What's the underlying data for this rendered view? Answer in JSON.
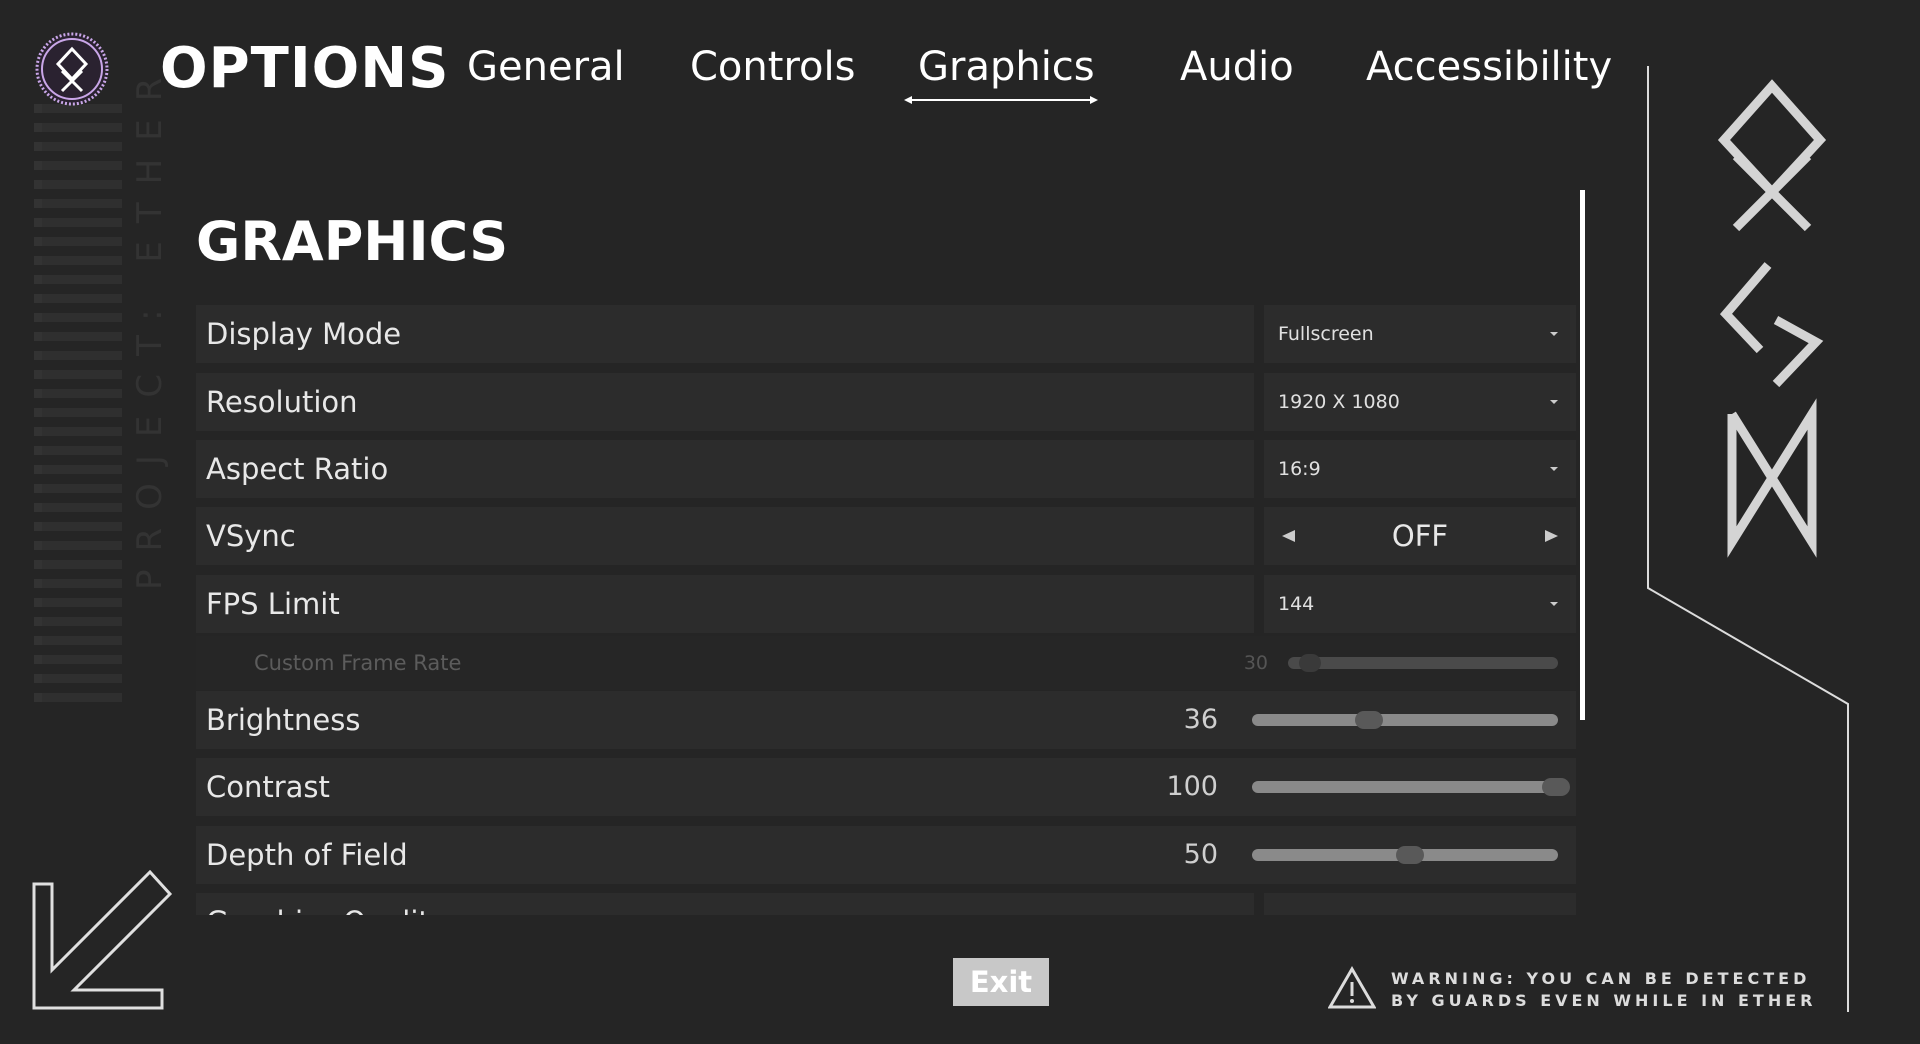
{
  "header": {
    "title": "OPTIONS",
    "tabs": [
      {
        "label": "General",
        "active": false
      },
      {
        "label": "Controls",
        "active": false
      },
      {
        "label": "Graphics",
        "active": true
      },
      {
        "label": "Audio",
        "active": false
      },
      {
        "label": "Accessibility",
        "active": false
      }
    ]
  },
  "decor": {
    "vertical_text": "PROJECT: ETHER"
  },
  "section": {
    "title": "GRAPHICS"
  },
  "settings": {
    "display_mode": {
      "label": "Display Mode",
      "value": "Fullscreen"
    },
    "resolution": {
      "label": "Resolution",
      "value": "1920 X 1080"
    },
    "aspect_ratio": {
      "label": "Aspect Ratio",
      "value": "16:9"
    },
    "vsync": {
      "label": "VSync",
      "value": "OFF"
    },
    "fps_limit": {
      "label": "FPS Limit",
      "value": "144"
    },
    "custom_frame_rate": {
      "label": "Custom Frame Rate",
      "value": "30",
      "fraction": 0.05
    },
    "brightness": {
      "label": "Brightness",
      "value": "36",
      "fraction": 0.36
    },
    "contrast": {
      "label": "Contrast",
      "value": "100",
      "fraction": 1.0
    },
    "depth_of_field": {
      "label": "Depth of Field",
      "value": "50",
      "fraction": 0.5
    },
    "graphics_quality": {
      "label": "Graphics Quality"
    }
  },
  "footer": {
    "exit_label": "Exit",
    "warning_line1": "WARNING: YOU CAN BE DETECTED",
    "warning_line2": "BY GUARDS EVEN WHILE IN ETHER"
  },
  "colors": {
    "background": "#252525",
    "row": "#2c2c2c",
    "accent_logo": "#c9a6e8",
    "text": "#e8e8e8"
  }
}
